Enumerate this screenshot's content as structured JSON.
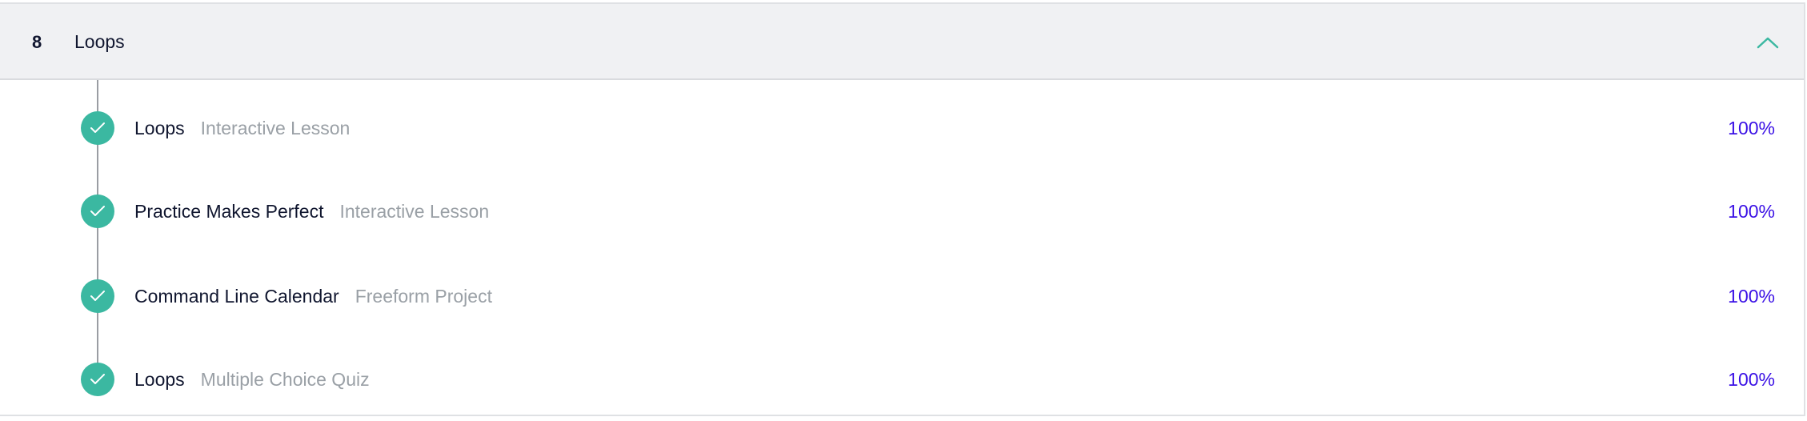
{
  "module": {
    "number": "8",
    "title": "Loops",
    "icon": "chevron-up-icon",
    "accent_color": "#3bb8a1"
  },
  "lessons": [
    {
      "name": "Loops",
      "type": "Interactive Lesson",
      "progress": "100%",
      "status": "completed",
      "icon": "checkmark-icon"
    },
    {
      "name": "Practice Makes Perfect",
      "type": "Interactive Lesson",
      "progress": "100%",
      "status": "completed",
      "icon": "checkmark-icon"
    },
    {
      "name": "Command Line Calendar",
      "type": "Freeform Project",
      "progress": "100%",
      "status": "completed",
      "icon": "checkmark-icon"
    },
    {
      "name": "Loops",
      "type": "Multiple Choice Quiz",
      "progress": "100%",
      "status": "completed",
      "icon": "checkmark-icon"
    }
  ],
  "colors": {
    "check_fill": "#3bb8a1",
    "progress_text": "#3a10e5",
    "secondary_text": "#9aa0a6",
    "header_bg": "#f0f1f3"
  }
}
